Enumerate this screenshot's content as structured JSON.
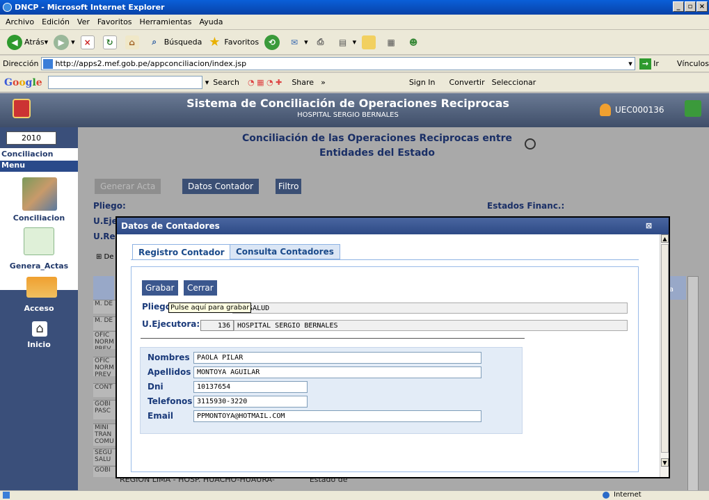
{
  "window": {
    "title": "DNCP - Microsoft Internet Explorer",
    "controls": [
      "_",
      "▫",
      "×"
    ]
  },
  "menubar": [
    "Archivo",
    "Edición",
    "Ver",
    "Favoritos",
    "Herramientas",
    "Ayuda"
  ],
  "toolbar": {
    "back": "Atrás",
    "search": "Búsqueda",
    "favorites": "Favoritos"
  },
  "address": {
    "label": "Dirección",
    "url": "http://apps2.mef.gob.pe/appconciliacion/index.jsp",
    "go": "Ir",
    "links": "Vínculos"
  },
  "googlebar": {
    "logo": "Google",
    "search": "Search",
    "share": "Share",
    "signin": "Sign In",
    "convertir": "Convertir",
    "seleccionar": "Seleccionar"
  },
  "app": {
    "title": "Sistema de Conciliación de Operaciones Reciprocas",
    "subtitle": "HOSPITAL SERGIO BERNALES",
    "user": "UEC000136"
  },
  "sidebar": {
    "year": "2010",
    "conciliacion_header": "Conciliacion",
    "menu_header": "Menu",
    "items": [
      {
        "label": "Conciliacion"
      },
      {
        "label": "Genera_Actas"
      },
      {
        "label": "Acceso"
      },
      {
        "label": "Inicio"
      }
    ]
  },
  "main": {
    "title_line1": "Conciliación de las Operaciones Reciprocas entre",
    "title_line2": "Entidades del Estado",
    "buttons": {
      "generar": "Generar Acta",
      "datos": "Datos Contador",
      "filtro": "Filtro"
    },
    "labels": {
      "pliego": "Pliego:",
      "estados": "Estados Financ.:",
      "uej": "U.Eje",
      "ure": "U.Re",
      "de": "⊞ De"
    },
    "bg_rows": [
      "M. DE",
      "M. DE",
      "OFIC NORM PREV",
      "OFIC NORM PREV",
      "CONT",
      "GOBI PASC",
      "MINI TRAN COMU",
      "SEGU SALU",
      "GOBI"
    ],
    "bottom_row": "REGION LIMA - HOSP. HUACHO-HUAURA-",
    "bottom_row_col": "Estado de",
    "col_header": "ta"
  },
  "modal": {
    "title": "Datos de Contadores",
    "tabs": {
      "registro": "Registro Contador",
      "consulta": "Consulta Contadores"
    },
    "buttons": {
      "grabar": "Grabar",
      "cerrar": "Cerrar"
    },
    "tooltip": "Pulse aquí para grabar",
    "pliego": {
      "label": "Pliego",
      "value": "DE SALUD"
    },
    "ue": {
      "label": "U.Ejecutora:",
      "code": "136",
      "value": "HOSPITAL SERGIO BERNALES"
    },
    "fields": [
      {
        "label": "Nombres",
        "value": "PAOLA PILAR"
      },
      {
        "label": "Apellidos",
        "value": "MONTOYA AGUILAR"
      },
      {
        "label": "Dni",
        "value": "10137654"
      },
      {
        "label": "Telefonos",
        "value": "3115930-3220"
      },
      {
        "label": "Email",
        "value": "PPMONTOYA@HOTMAIL.COM"
      }
    ]
  },
  "status": {
    "zone": "Internet"
  }
}
